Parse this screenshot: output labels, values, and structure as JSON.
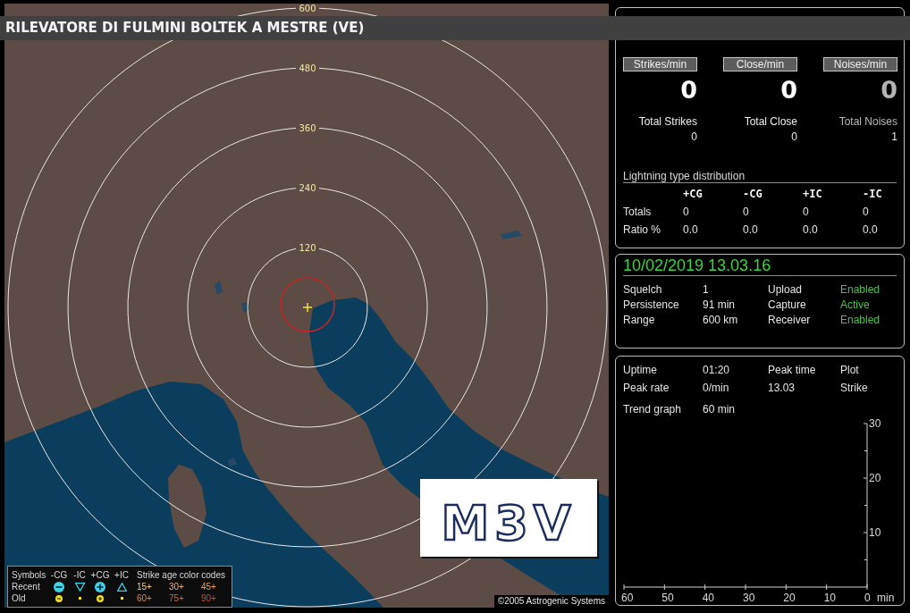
{
  "title_bar": {
    "title": "RILEVATORE DI FULMINI BOLTEK A MESTRE (VE)"
  },
  "map": {
    "range_rings": [
      {
        "label": "600"
      },
      {
        "label": "480"
      },
      {
        "label": "360"
      },
      {
        "label": "240"
      },
      {
        "label": "120"
      }
    ],
    "logo": {
      "text": "M3V"
    },
    "copyright": "©2005 Astrogenic Systems",
    "legend": {
      "label": "Symbols",
      "symbols": [
        "-CG",
        "-IC",
        "+CG",
        "+IC"
      ],
      "age_title": "Strike age color codes",
      "rows": [
        {
          "label": "Recent",
          "kind": "recent",
          "ages": [
            {
              "text": "15+",
              "color": "#f6c98a"
            },
            {
              "text": "30+",
              "color": "#f0ad6c"
            },
            {
              "text": "45+",
              "color": "#ec9a5c"
            }
          ]
        },
        {
          "label": "Old",
          "kind": "old",
          "ages": [
            {
              "text": "60+",
              "color": "#d98a5a"
            },
            {
              "text": "75+",
              "color": "#cf6a4a"
            },
            {
              "text": "90+",
              "color": "#cc4b3c"
            }
          ]
        }
      ]
    }
  },
  "counters": [
    {
      "button": "Strikes/min",
      "value": "0",
      "total_label": "Total Strikes",
      "total": "0",
      "dimmed": false
    },
    {
      "button": "Close/min",
      "value": "0",
      "total_label": "Total Close",
      "total": "0",
      "dimmed": false
    },
    {
      "button": "Noises/min",
      "value": "0",
      "total_label": "Total Noises",
      "total": "1",
      "dimmed": true
    }
  ],
  "distribution": {
    "title": "Lightning type distribution",
    "columns": [
      "+CG",
      "-CG",
      "+IC",
      "-IC"
    ],
    "rows": [
      {
        "label": "Totals",
        "values": [
          "0",
          "0",
          "0",
          "0"
        ]
      },
      {
        "label": "Ratio %",
        "values": [
          "0.0",
          "0.0",
          "0.0",
          "0.0"
        ]
      }
    ]
  },
  "status": {
    "datetime": "10/02/2019 13.03.16",
    "rows": [
      {
        "label": "Squelch",
        "value": "1",
        "status_label": "Upload",
        "status": "Enabled",
        "active": true
      },
      {
        "label": "Persistence",
        "value": "91 min",
        "status_label": "Capture",
        "status": "Active",
        "active": true
      },
      {
        "label": "Range",
        "value": "600 km",
        "status_label": "Receiver",
        "status": "Enabled",
        "active": true
      }
    ]
  },
  "trend": {
    "rows": [
      {
        "cells": [
          "Uptime",
          "01:20",
          "Peak time",
          "Plot"
        ]
      },
      {
        "cells": [
          "Peak rate",
          "0/min",
          "13.03",
          "Strike"
        ]
      },
      {
        "cells": [
          "Trend graph",
          "60 min"
        ]
      }
    ],
    "chart_data": {
      "type": "line",
      "xlabel": "min",
      "xlim": [
        60,
        0
      ],
      "ylim": [
        0,
        30
      ],
      "xticks": [
        60,
        50,
        40,
        30,
        20,
        10,
        0
      ],
      "yticks": [
        10,
        20,
        30
      ]
    }
  }
}
